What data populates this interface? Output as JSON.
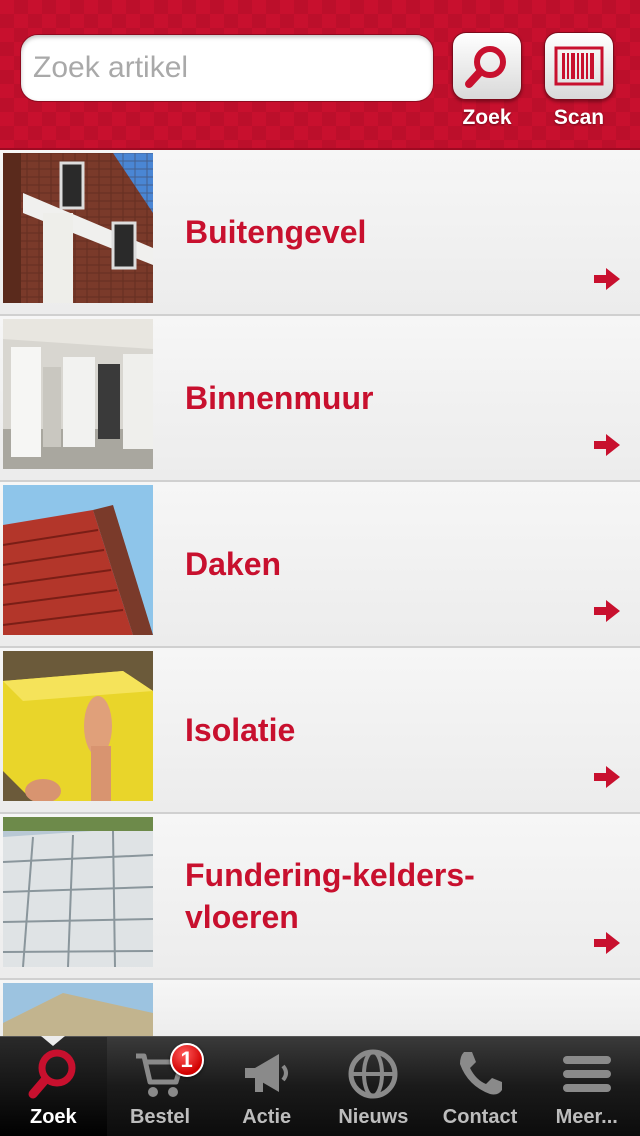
{
  "search": {
    "placeholder": "Zoek artikel",
    "value": ""
  },
  "header": {
    "zoek_label": "Zoek",
    "scan_label": "Scan"
  },
  "categories": [
    {
      "label": "Buitengevel",
      "image": "brick-facade"
    },
    {
      "label": "Binnenmuur",
      "image": "interior-walls"
    },
    {
      "label": "Daken",
      "image": "tiled-roof"
    },
    {
      "label": "Isolatie",
      "image": "insulation"
    },
    {
      "label": "Fundering-kelders-vloeren",
      "label_line1": "Fundering-kelders-",
      "label_line2": "vloeren",
      "image": "foundation-floor"
    }
  ],
  "tabs": [
    {
      "label": "Zoek",
      "icon": "search-icon",
      "active": true
    },
    {
      "label": "Bestel",
      "icon": "cart-icon",
      "badge": "1"
    },
    {
      "label": "Actie",
      "icon": "megaphone-icon"
    },
    {
      "label": "Nieuws",
      "icon": "globe-icon"
    },
    {
      "label": "Contact",
      "icon": "phone-icon"
    },
    {
      "label": "Meer...",
      "icon": "menu-icon"
    }
  ],
  "colors": {
    "brand_red": "#c8102e",
    "tab_bar": "#1a1a1a",
    "list_background": "#ececec"
  }
}
